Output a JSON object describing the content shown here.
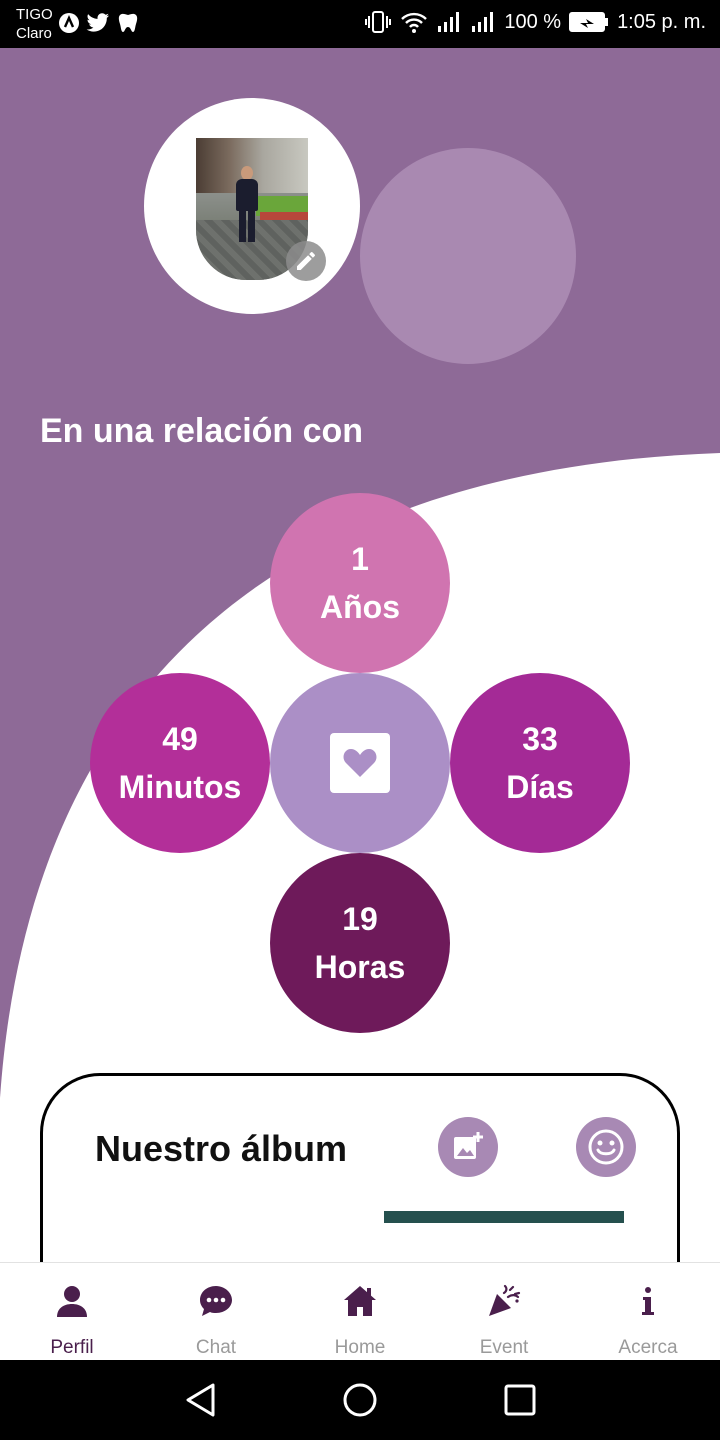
{
  "status_bar": {
    "carrier_line1": "TIGO",
    "carrier_line2": "Claro",
    "battery": "100 %",
    "time": "1:05 p. m."
  },
  "profile": {
    "relation_title": "En una relación con"
  },
  "counters": {
    "years": {
      "value": "1",
      "unit": "Años"
    },
    "minutes": {
      "value": "49",
      "unit": "Minutos"
    },
    "days": {
      "value": "33",
      "unit": "Días"
    },
    "hours": {
      "value": "19",
      "unit": "Horas"
    }
  },
  "album": {
    "title": "Nuestro álbum"
  },
  "bottom_nav": {
    "items": [
      {
        "label": "Perfil",
        "icon": "person-icon",
        "active": true
      },
      {
        "label": "Chat",
        "icon": "chat-icon",
        "active": false
      },
      {
        "label": "Home",
        "icon": "home-icon",
        "active": false
      },
      {
        "label": "Event",
        "icon": "party-popper-icon",
        "active": false
      },
      {
        "label": "Acerca",
        "icon": "info-icon",
        "active": false
      }
    ]
  },
  "colors": {
    "background_purple": "#8e6a97",
    "partner_circle": "#a989b1",
    "years": "#d074b0",
    "minutes": "#b32f99",
    "heart": "#ab8fc6",
    "days": "#a42a96",
    "hours": "#6e1a5a",
    "nav_active": "#4a1f4c",
    "nav_inactive": "#9a9a9a"
  }
}
